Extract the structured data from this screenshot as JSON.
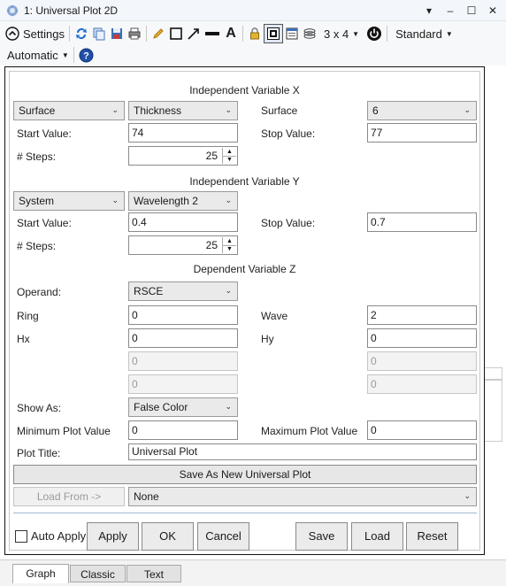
{
  "window": {
    "title": "1: Universal Plot 2D",
    "controls": [
      "▾",
      "–",
      "☐",
      "✕"
    ]
  },
  "toolbar": {
    "settings_label": "Settings",
    "layout_label": "3 x 4",
    "standard_label": "Standard",
    "automatic_label": "Automatic",
    "text_tool_glyph": "A"
  },
  "x": {
    "header": "Independent Variable X",
    "category": "Surface",
    "parameter": "Thickness",
    "surface_label": "Surface",
    "surface_value": "6",
    "start_label": "Start Value:",
    "start_value": "74",
    "stop_label": "Stop Value:",
    "stop_value": "77",
    "steps_label": "# Steps:",
    "steps_value": "25"
  },
  "y": {
    "header": "Independent Variable Y",
    "category": "System",
    "parameter": "Wavelength 2",
    "start_label": "Start Value:",
    "start_value": "0.4",
    "stop_label": "Stop Value:",
    "stop_value": "0.7",
    "steps_label": "# Steps:",
    "steps_value": "25"
  },
  "z": {
    "header": "Dependent Variable Z",
    "operand_label": "Operand:",
    "operand_value": "RSCE",
    "ring_label": "Ring",
    "ring_value": "0",
    "wave_label": "Wave",
    "wave_value": "2",
    "hx_label": "Hx",
    "hx_value": "0",
    "hy_label": "Hy",
    "hy_value": "0",
    "extra1_left": "0",
    "extra1_right": "0",
    "extra2_left": "0",
    "extra2_right": "0"
  },
  "display": {
    "show_as_label": "Show As:",
    "show_as_value": "False Color",
    "min_label": "Minimum Plot Value",
    "min_value": "0",
    "max_label": "Maximum Plot Value",
    "max_value": "0",
    "title_label": "Plot Title:",
    "title_value": "Universal Plot"
  },
  "actions": {
    "save_new": "Save As New Universal Plot",
    "load_from": "Load From ->",
    "load_from_value": "None",
    "auto_apply": "Auto Apply",
    "apply": "Apply",
    "ok": "OK",
    "cancel": "Cancel",
    "save": "Save",
    "load": "Load",
    "reset": "Reset"
  },
  "tabs": [
    "Graph",
    "Classic",
    "Text"
  ],
  "colors": {
    "accent": "#1f5fbf",
    "divider": "#9fb7d4",
    "help": "#1f4fa8"
  }
}
